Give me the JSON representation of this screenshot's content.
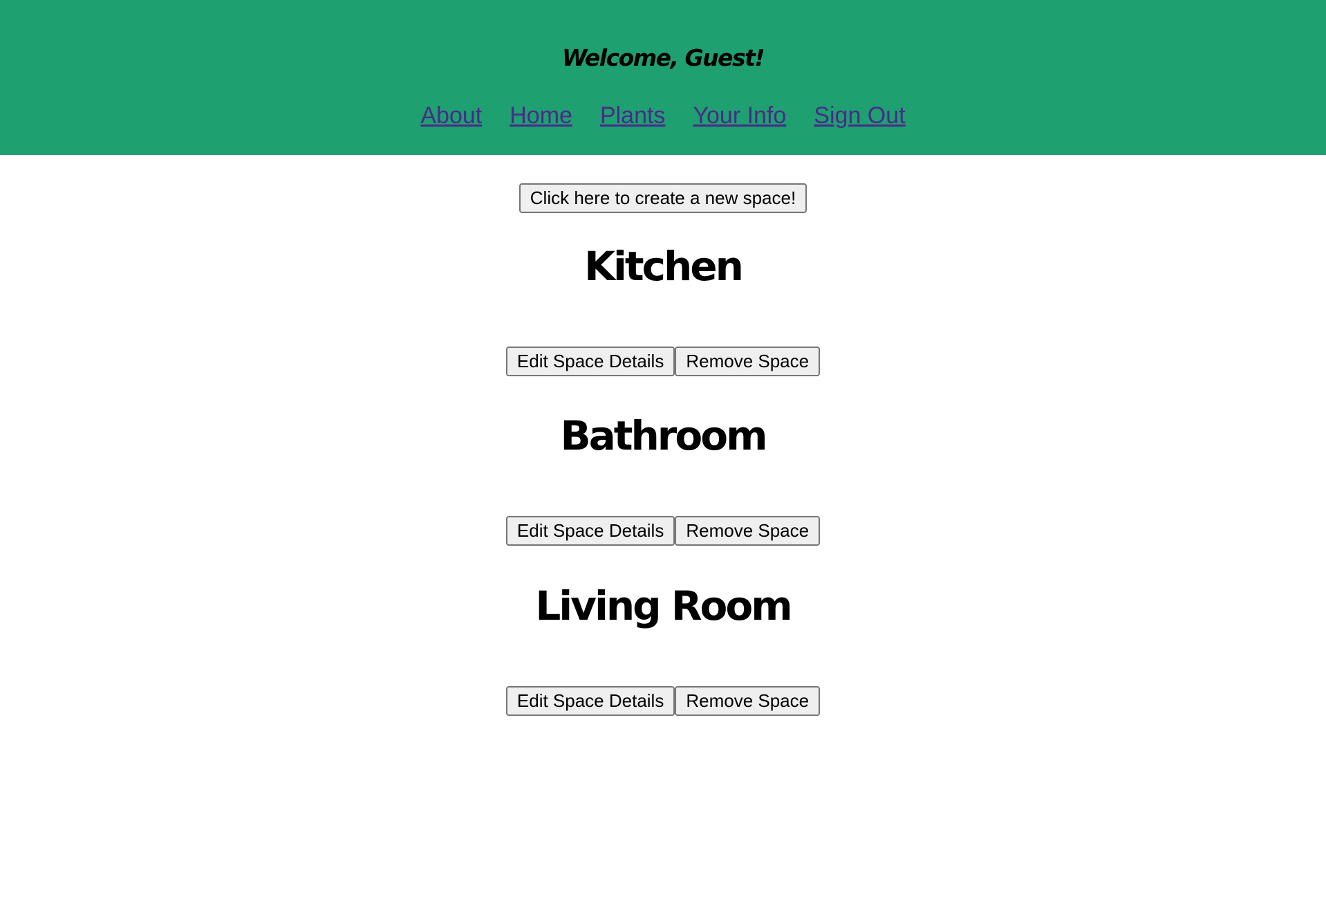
{
  "header": {
    "welcome": "Welcome, Guest!",
    "nav": [
      {
        "label": "About"
      },
      {
        "label": "Home"
      },
      {
        "label": "Plants"
      },
      {
        "label": "Your Info"
      },
      {
        "label": "Sign Out"
      }
    ],
    "background_color": "#1ea070",
    "link_color": "#4a2a8a"
  },
  "main": {
    "create_button_label": "Click here to create a new space!",
    "spaces": [
      {
        "name": "Kitchen",
        "edit_label": "Edit Space Details",
        "remove_label": "Remove Space"
      },
      {
        "name": "Bathroom",
        "edit_label": "Edit Space Details",
        "remove_label": "Remove Space"
      },
      {
        "name": "Living Room",
        "edit_label": "Edit Space Details",
        "remove_label": "Remove Space"
      }
    ]
  }
}
